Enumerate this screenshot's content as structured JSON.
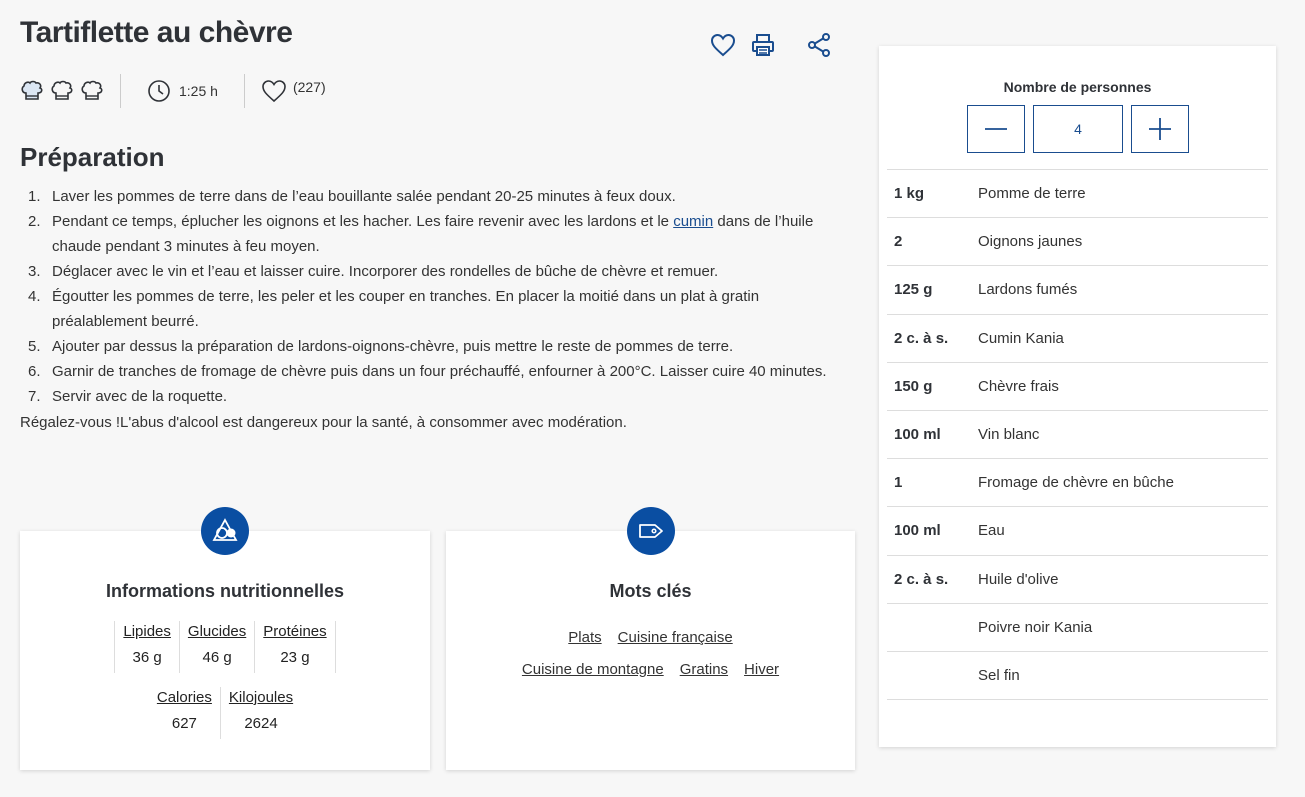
{
  "recipe": {
    "title": "Tartiflette au chèvre",
    "time": "1:25 h",
    "likes": "(227)",
    "difficulty_icons": [
      "chef-hat-icon",
      "chef-hat-icon",
      "chef-hat-icon"
    ]
  },
  "preparation": {
    "title": "Préparation",
    "steps": [
      {
        "num": "1.",
        "text": "Laver les pommes de terre dans de l’eau bouillante salée pendant 20-25 minutes à feux doux."
      },
      {
        "num": "2.",
        "pre": "Pendant ce temps, éplucher les oignons et les hacher. Les faire revenir avec les lardons et le ",
        "link": "cumin",
        "post": " dans de l’huile chaude pendant 3 minutes à feu moyen."
      },
      {
        "num": "3.",
        "text": "Déglacer avec le vin et l’eau et laisser cuire. Incorporer des rondelles de bûche de chèvre et remuer."
      },
      {
        "num": "4.",
        "text": "Égoutter les pommes de terre, les peler et les couper en tranches. En placer la moitié dans un plat à gratin préalablement beurré."
      },
      {
        "num": "5.",
        "text": "Ajouter par dessus la préparation de lardons-oignons-chèvre, puis mettre le reste de pommes de terre."
      },
      {
        "num": "6.",
        "text": "Garnir de tranches de fromage de chèvre puis dans un four préchauffé, enfourner à 200°C. Laisser cuire 40 minutes."
      },
      {
        "num": "7.",
        "text": "Servir avec de la roquette."
      }
    ],
    "note": "Régalez-vous !L'abus d'alcool est dangereux pour la santé, à consommer avec modération."
  },
  "nutrition": {
    "title": "Informations nutritionnelles",
    "row1": [
      {
        "label": "Lipides",
        "value": "36 g"
      },
      {
        "label": "Glucides",
        "value": "46 g"
      },
      {
        "label": "Protéines",
        "value": "23 g"
      }
    ],
    "row2": [
      {
        "label": "Calories",
        "value": "627"
      },
      {
        "label": "Kilojoules",
        "value": "2624"
      }
    ]
  },
  "keywords": {
    "title": "Mots clés",
    "row1": [
      "Plats",
      "Cuisine française"
    ],
    "row2": [
      "Cuisine de montagne",
      "Gratins",
      "Hiver"
    ]
  },
  "servings": {
    "label": "Nombre de personnes",
    "count": "4"
  },
  "ingredients": [
    {
      "qty": "1 kg",
      "name": "Pomme de terre"
    },
    {
      "qty": "2",
      "name": "Oignons jaunes"
    },
    {
      "qty": "125 g",
      "name": "Lardons fumés"
    },
    {
      "qty": "2 c. à s.",
      "name": "Cumin  Kania"
    },
    {
      "qty": "150 g",
      "name": "Chèvre frais"
    },
    {
      "qty": "100 ml",
      "name": "Vin blanc"
    },
    {
      "qty": "1",
      "name": "Fromage de chèvre en bûche"
    },
    {
      "qty": "100 ml",
      "name": "Eau"
    },
    {
      "qty": "2 c. à s.",
      "name": "Huile d'olive"
    },
    {
      "qty": "",
      "name": "Poivre noir  Kania"
    },
    {
      "qty": "",
      "name": "Sel fin"
    }
  ],
  "colors": {
    "brand_blue": "#0a4ea2",
    "link_blue": "#1a4d8f",
    "text": "#333333"
  }
}
